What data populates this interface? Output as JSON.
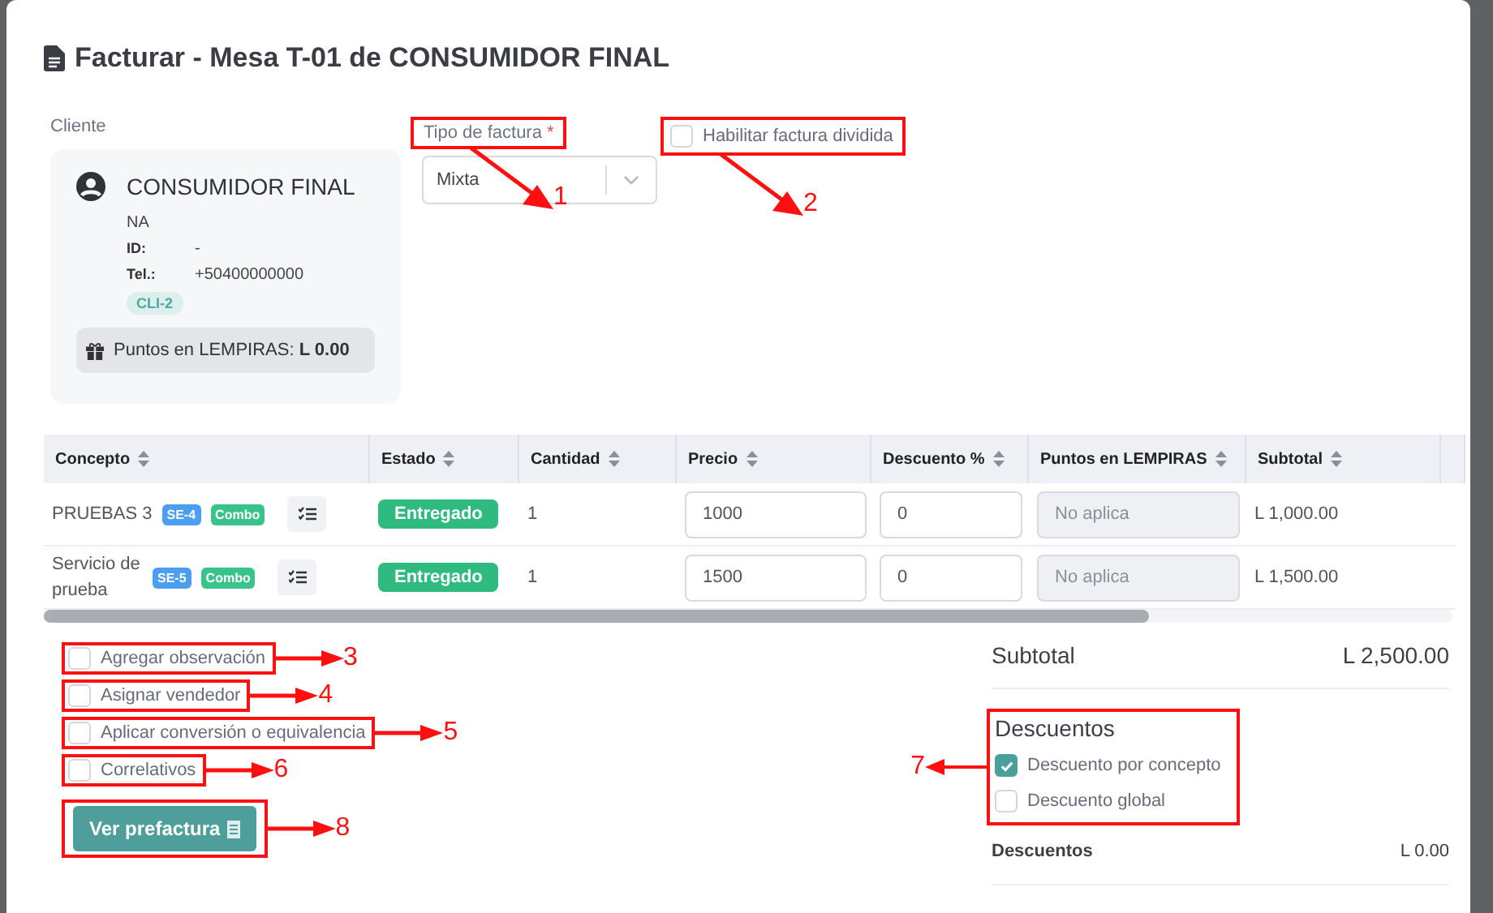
{
  "title": "Facturar - Mesa T-01 de CONSUMIDOR FINAL",
  "client": {
    "label": "Cliente",
    "name": "CONSUMIDOR FINAL",
    "subtitle": "NA",
    "fields": [
      {
        "label": "ID:",
        "value": "-"
      },
      {
        "label": "Tel.:",
        "value": "+50400000000"
      }
    ],
    "tag": "CLI-2",
    "points": "Puntos en LEMPIRAS: **L 0.00**"
  },
  "invoice_type": {
    "label": "Tipo de factura",
    "required_mark": "*",
    "value": "Mixta",
    "callout": {
      "label": "1"
    }
  },
  "split_invoice": {
    "label": "Habilitar factura dividida",
    "checked": false,
    "callout": {
      "label": "2"
    }
  },
  "table": {
    "columns": [
      {
        "label": "Concepto"
      },
      {
        "label": "Estado"
      },
      {
        "label": "Cantidad"
      },
      {
        "label": "Precio"
      },
      {
        "label": "Descuento %"
      },
      {
        "label": "Puntos en LEMPIRAS"
      },
      {
        "label": "Subtotal"
      }
    ],
    "rows": [
      {
        "concept": "PRUEBAS 3",
        "code": "SE-4",
        "tag": "Combo",
        "status": "Entregado",
        "quantity": "1",
        "price": "1000",
        "discount": "0",
        "points_placeholder": "No aplica",
        "subtotal": "L 1,000.00"
      },
      {
        "concept": "Servicio de prueba",
        "code": "SE-5",
        "tag": "Combo",
        "status": "Entregado",
        "quantity": "1",
        "price": "1500",
        "discount": "0",
        "points_placeholder": "No aplica",
        "subtotal": "L 1,500.00"
      }
    ]
  },
  "options": [
    {
      "label": "Agregar observación",
      "checked": false,
      "callout": {
        "label": "3"
      }
    },
    {
      "label": "Asignar vendedor",
      "checked": false,
      "callout": {
        "label": "4"
      }
    },
    {
      "label": "Aplicar conversión o equivalencia",
      "checked": false,
      "callout": {
        "label": "5"
      }
    },
    {
      "label": "Correlativos",
      "checked": false,
      "callout": {
        "label": "6"
      }
    }
  ],
  "preview_button": {
    "label": "Ver prefactura",
    "callout": {
      "label": "8"
    }
  },
  "summary": {
    "subtotal_label": "Subtotal",
    "subtotal": "L 2,500.00",
    "discounts": {
      "title": "Descuentos",
      "options": [
        {
          "label": "Descuento por concepto",
          "checked": true
        },
        {
          "label": "Descuento global",
          "checked": false
        }
      ],
      "callout": {
        "label": "7"
      }
    },
    "discount_label": "Descuentos",
    "discount_value": "L 0.00"
  }
}
